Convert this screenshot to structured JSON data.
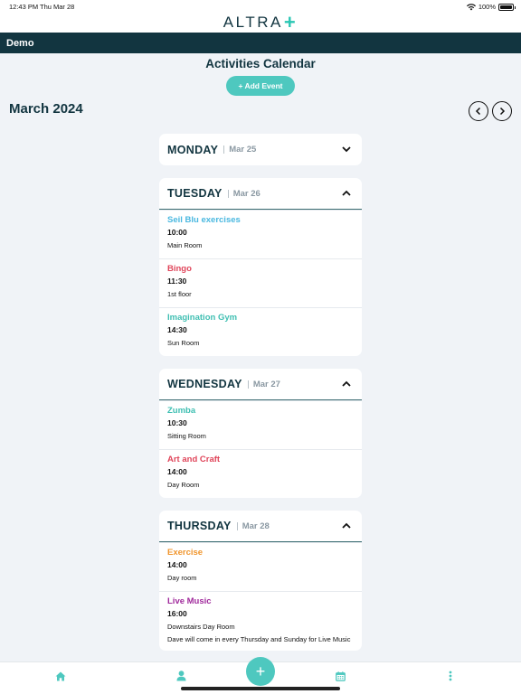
{
  "status_bar": {
    "time": "12:43 PM",
    "date": "Thu Mar 28",
    "battery": "100%"
  },
  "header": {
    "logo_text": "ALTRA",
    "logo_mark": "+"
  },
  "org_bar": {
    "name": "Demo"
  },
  "page": {
    "title": "Activities Calendar",
    "add_event_label": "+ Add Event",
    "month_label": "March 2024"
  },
  "days": [
    {
      "name": "MONDAY",
      "date": "Mar 25",
      "expanded": false,
      "events": []
    },
    {
      "name": "TUESDAY",
      "date": "Mar 26",
      "expanded": true,
      "events": [
        {
          "title": "Seil Blu exercises",
          "time": "10:00",
          "location": "Main Room",
          "color": "#4ab8e0"
        },
        {
          "title": "Bingo",
          "time": "11:30",
          "location": "1st floor",
          "color": "#e0455a"
        },
        {
          "title": "Imagination Gym",
          "time": "14:30",
          "location": "Sun Room",
          "color": "#3fbfb2"
        }
      ]
    },
    {
      "name": "WEDNESDAY",
      "date": "Mar 27",
      "expanded": true,
      "events": [
        {
          "title": "Zumba",
          "time": "10:30",
          "location": "Sitting Room",
          "color": "#3fbfb2"
        },
        {
          "title": "Art and Craft",
          "time": "14:00",
          "location": "Day Room",
          "color": "#e0455a"
        }
      ]
    },
    {
      "name": "THURSDAY",
      "date": "Mar 28",
      "expanded": true,
      "events": [
        {
          "title": "Exercise",
          "time": "14:00",
          "location": "Day room",
          "color": "#f0962e"
        },
        {
          "title": "Live Music",
          "time": "16:00",
          "location": "Downstairs Day Room",
          "note": "Dave will come in every Thursday and Sunday for Live Music",
          "color": "#a02a9c"
        }
      ]
    }
  ],
  "tab_bar": {
    "icons": [
      "home-icon",
      "person-icon",
      "plus-icon",
      "calendar-icon",
      "more-icon"
    ],
    "fab_label": "+"
  },
  "colors": {
    "brand_dark": "#123540",
    "accent": "#4ec8bf",
    "background": "#f0f3f7"
  }
}
